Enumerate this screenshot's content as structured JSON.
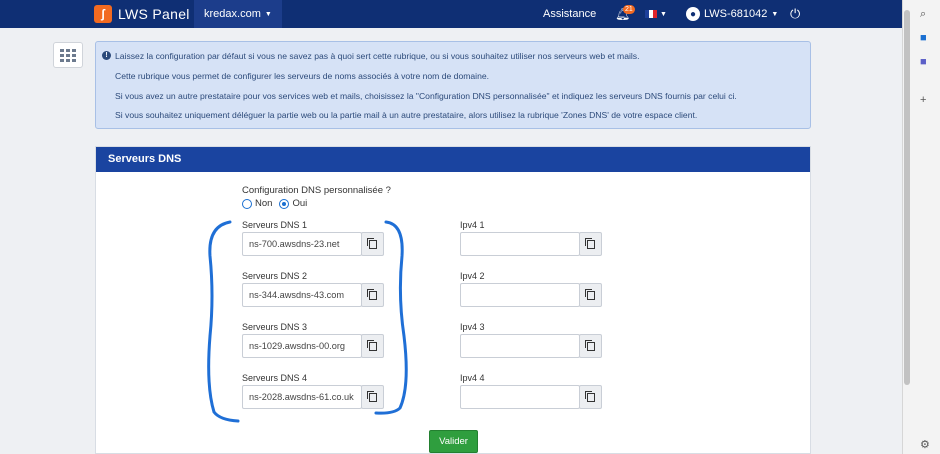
{
  "navbar": {
    "brand": "LWS Panel",
    "brand_logo": "lws-logo",
    "domain": "kredax.com",
    "assistance": "Assistance",
    "notifications_count": "21",
    "account": "LWS-681042",
    "icons": [
      "bell-icon",
      "flag-fr-icon",
      "user-avatar-icon",
      "power-icon"
    ]
  },
  "alert": {
    "icon": "info-icon",
    "lines": [
      "Laissez la configuration par défaut si vous ne savez pas à quoi sert cette rubrique, ou si vous souhaitez utiliser nos serveurs web et mails.",
      "Cette rubrique vous permet de configurer les serveurs de noms associés à votre nom de domaine.",
      "Si vous avez un autre prestataire pour vos services web et mails, choisissez la \"Configuration DNS personnalisée\" et indiquez les serveurs DNS fournis par celui ci.",
      "Si vous souhaitez uniquement déléguer la partie web ou la partie mail à un autre prestataire, alors utilisez la rubrique 'Zones DNS' de votre espace client."
    ]
  },
  "card": {
    "title": "Serveurs DNS",
    "config_label": "Configuration DNS personnalisée ?",
    "options": [
      {
        "label": "Non",
        "selected": false
      },
      {
        "label": "Oui",
        "selected": true
      }
    ],
    "dns": [
      {
        "label": "Serveurs DNS 1",
        "value": "ns-700.awsdns-23.net"
      },
      {
        "label": "Serveurs DNS 2",
        "value": "ns-344.awsdns-43.com"
      },
      {
        "label": "Serveurs DNS 3",
        "value": "ns-1029.awsdns-00.org"
      },
      {
        "label": "Serveurs DNS 4",
        "value": "ns-2028.awsdns-61.co.uk"
      }
    ],
    "ipv4": [
      {
        "label": "Ipv4 1",
        "value": ""
      },
      {
        "label": "Ipv4 2",
        "value": ""
      },
      {
        "label": "Ipv4 3",
        "value": ""
      },
      {
        "label": "Ipv4 4",
        "value": ""
      }
    ],
    "submit": "Valider"
  },
  "colors": {
    "navbar": "#0f2f74",
    "card_header": "#1a44a0",
    "submit": "#2f9e3e",
    "annotation": "#1f6fd6"
  }
}
